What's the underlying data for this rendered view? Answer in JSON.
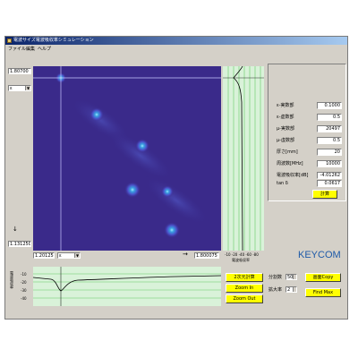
{
  "window": {
    "title": "電波サイズ電波吸収率シミュレーション"
  },
  "menu": {
    "items": [
      "ファイル",
      "編集",
      "ヘルプ"
    ]
  },
  "heatmap": {
    "y_max_label": "1.80700",
    "y_min_label": "1.131250",
    "x_min_label": "1.20125",
    "x_max_label": "1.800075",
    "left_combo": "ε",
    "bottom_combo": "ε"
  },
  "params": [
    {
      "label": "ε-実数部",
      "value": "0.1000"
    },
    {
      "label": "ε-虚数部",
      "value": "0.5"
    },
    {
      "label": "μ-実数部",
      "value": "20497"
    },
    {
      "label": "μ-虚数部",
      "value": "0.5"
    },
    {
      "label": "厚さ[mm]",
      "value": "20"
    },
    {
      "label": "周波数[MHz]",
      "value": "10000"
    },
    {
      "label": "電波吸収率[dB]",
      "value": "-4.01262"
    },
    {
      "label": "tan δ",
      "value": "0.0617"
    }
  ],
  "calc_button": "計算",
  "right_plot": {
    "ticks": "-10 -20 -40 -60 -80",
    "axis_label": "電波吸収率"
  },
  "bottom_plot": {
    "y_ticks": [
      "-10",
      "-20",
      "-30",
      "-40"
    ],
    "axis_label": "電波吸収率"
  },
  "buttons": {
    "display_2d": "2次元計算",
    "zoom_in": "Zoom In",
    "zoom_out": "Zoom Out",
    "copy": "画面Copy",
    "find_max": "Find Max"
  },
  "controls": {
    "divisions_label": "分割数",
    "divisions_value": "50",
    "zoom_label": "拡大率",
    "zoom_value": "2"
  },
  "brand": "KEYCOM",
  "colors": {
    "accent_button": "#ffff00",
    "heatmap_bg": "#3a2a8a",
    "grid_green": "#66cc66",
    "brand": "#1e5aa8"
  }
}
